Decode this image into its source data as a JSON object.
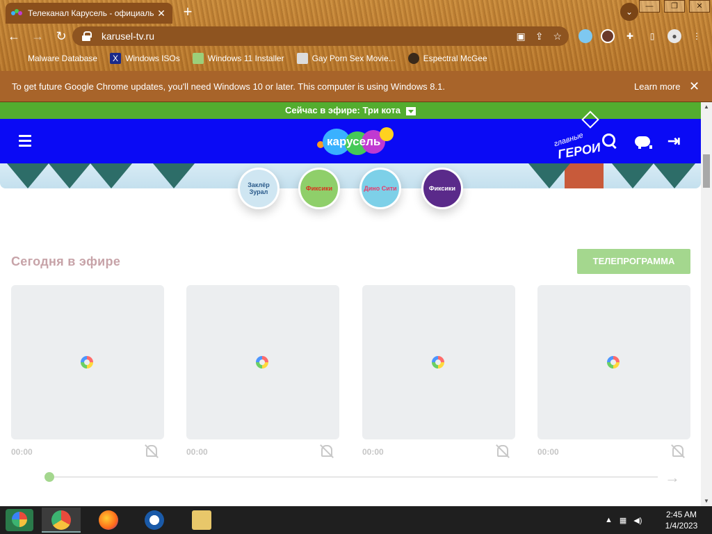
{
  "browser": {
    "tab_title": "Телеканал Карусель - официаль",
    "tab_close": "✕",
    "new_tab": "+",
    "url": "karusel-tv.ru",
    "window_minimize": "—",
    "window_restore": "❐",
    "window_close": "✕",
    "bookmarks": [
      {
        "label": "Malware Database"
      },
      {
        "label": "Windows ISOs"
      },
      {
        "label": "Windows 11 Installer"
      },
      {
        "label": "Gay Porn Sex Movie..."
      },
      {
        "label": "Espectral McGee"
      }
    ]
  },
  "infobar": {
    "message": "To get future Google Chrome updates, you'll need Windows 10 or later. This computer is using Windows 8.1.",
    "learn_more": "Learn more",
    "close": "✕"
  },
  "site": {
    "on_air_text": "Сейчас в эфире: Три кота",
    "logo_text": "карусель",
    "heroes_line1": "главные",
    "heroes_line2": "ГЕРОИ",
    "login_icon": "⇥",
    "shows": [
      {
        "label": "Заклёр Зурал"
      },
      {
        "label": "Фиксики"
      },
      {
        "label": "Дино Сити"
      },
      {
        "label": "Фиксики"
      }
    ],
    "today_title": "Сегодня в эфире",
    "tv_program_button": "ТЕЛЕПРОГРАММА",
    "cards": [
      {
        "time": "00:00"
      },
      {
        "time": "00:00"
      },
      {
        "time": "00:00"
      },
      {
        "time": "00:00"
      }
    ],
    "next_arrow": "→"
  },
  "taskbar": {
    "tray_up": "▲",
    "time": "2:45 AM",
    "date": "1/4/2023"
  },
  "colors": {
    "on_air_bg": "#53ad2f",
    "nav_bg": "#0a0af5",
    "tv_button_bg": "#a4d78e",
    "title_color": "#c7a3a8"
  }
}
